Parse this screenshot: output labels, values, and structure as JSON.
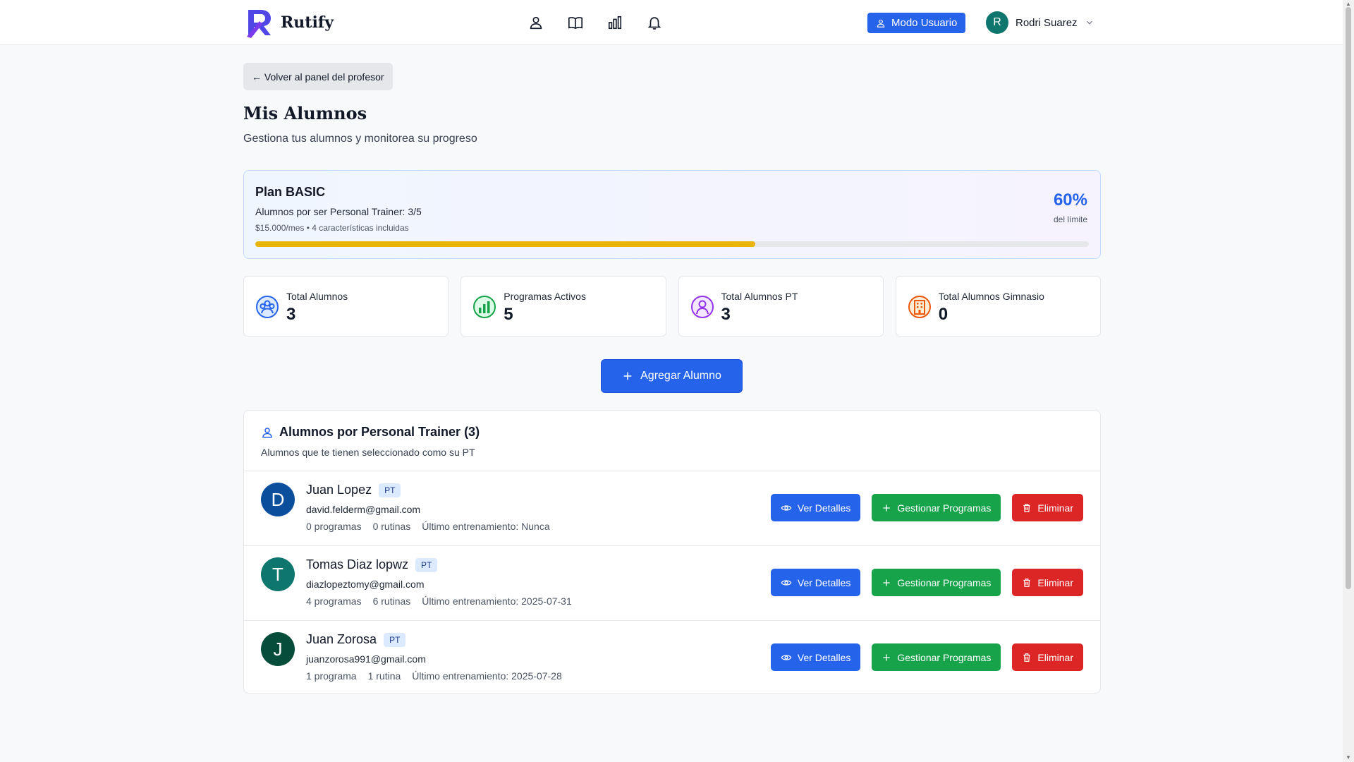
{
  "header": {
    "brand": "Rutify",
    "nav": [
      "user-icon",
      "book-icon",
      "bar-chart-icon",
      "bell-icon"
    ],
    "mode_button": "Modo Usuario",
    "user_initial": "R",
    "user_name": "Rodri Suarez"
  },
  "back_button": "← Volver al panel del profesor",
  "page": {
    "title": "Mis Alumnos",
    "subtitle": "Gestiona tus alumnos y monitorea su progreso"
  },
  "plan": {
    "title": "Plan BASIC",
    "students": "Alumnos por ser Personal Trainer: 3/5",
    "price": "$15.000/mes • 4 características incluidas",
    "percent_label": "60%",
    "percent_value": 60,
    "limit_label": "del límite",
    "bar_color": "#eab308"
  },
  "stats": [
    {
      "label": "Total Alumnos",
      "value": "3",
      "icon": "users-icon",
      "color": "#2563eb"
    },
    {
      "label": "Programas Activos",
      "value": "5",
      "icon": "chart-icon",
      "color": "#16a34a"
    },
    {
      "label": "Total Alumnos PT",
      "value": "3",
      "icon": "user-icon",
      "color": "#9333ea"
    },
    {
      "label": "Total Alumnos Gimnasio",
      "value": "0",
      "icon": "building-icon",
      "color": "#ea580c"
    }
  ],
  "add_button": "Agregar Alumno",
  "list": {
    "title": "Alumnos por Personal Trainer (3)",
    "subtitle": "Alumnos que te tienen seleccionado como su PT",
    "badge": "PT",
    "actions": {
      "details": "Ver Detalles",
      "programs": "Gestionar Programas",
      "delete": "Eliminar"
    },
    "students": [
      {
        "initial": "D",
        "name": "Juan Lopez",
        "email": "david.felderm@gmail.com",
        "programs": "0 programas",
        "routines": "0 rutinas",
        "last": "Último entrenamiento: Nunca",
        "color": "#0b4f9c"
      },
      {
        "initial": "T",
        "name": "Tomas Diaz lopwz",
        "email": "diazlopeztomy@gmail.com",
        "programs": "4 programas",
        "routines": "6 rutinas",
        "last": "Último entrenamiento: 2025-07-31",
        "color": "#0f766e"
      },
      {
        "initial": "J",
        "name": "Juan Zorosa",
        "email": "juanzorosa991@gmail.com",
        "programs": "1 programa",
        "routines": "1 rutina",
        "last": "Último entrenamiento: 2025-07-28",
        "color": "#064e3b"
      }
    ]
  }
}
